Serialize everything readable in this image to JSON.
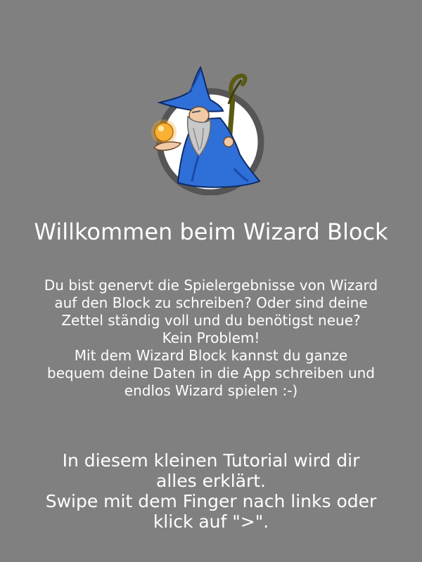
{
  "welcome": {
    "title": "Willkommen beim Wizard Block",
    "intro_lines": [
      "Du bist genervt die Spielergebnisse von Wizard",
      "auf den Block zu schreiben? Oder sind deine",
      "Zettel ständig voll und du benötigst neue?",
      "Kein Problem!",
      "Mit dem Wizard Block kannst du ganze",
      "bequem deine Daten in die App schreiben und",
      "endlos Wizard spielen :-)"
    ],
    "hint_lines": [
      "In diesem kleinen Tutorial wird dir",
      "alles erklärt.",
      "Swipe mit dem Finger nach links oder",
      "klick auf \">\"."
    ]
  },
  "colors": {
    "background": "#808080",
    "text": "#ffffff",
    "robe": "#2f6fd8",
    "ring": "#555555",
    "staff": "#5a5a12",
    "orb": "#f5a623"
  },
  "icons": {
    "logo": "wizard-logo-icon"
  }
}
